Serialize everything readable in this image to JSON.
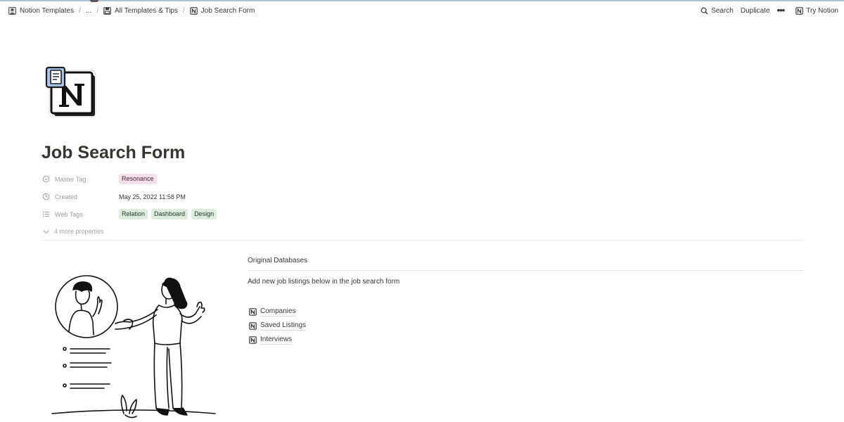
{
  "breadcrumb": {
    "workspace": "Notion Templates",
    "ellipsis": "...",
    "parent": "All Templates & Tips",
    "current": "Job Search Form"
  },
  "topbar": {
    "search": "Search",
    "duplicate": "Duplicate",
    "more": "•••",
    "try_notion": "Try Notion"
  },
  "page": {
    "title": "Job Search Form",
    "icon": "notion-logo-with-document-icon"
  },
  "properties": {
    "master_tag": {
      "label": "Master Tag",
      "value": "Resonance"
    },
    "created": {
      "label": "Created",
      "value": "May 25, 2022 11:58 PM"
    },
    "web_tags": {
      "label": "Web Tags",
      "values": [
        "Relation",
        "Dashboard",
        "Design"
      ]
    },
    "more": "4 more properties"
  },
  "databases": {
    "header": "Original Databases",
    "description": "Add new job listings below in the job search form",
    "links": [
      "Companies",
      "Saved Listings",
      "Interviews"
    ]
  },
  "colors": {
    "text": "#37352f",
    "muted": "#9b9a97",
    "tag_pink": "#f4dfeb",
    "tag_green": "#dbeddb"
  }
}
